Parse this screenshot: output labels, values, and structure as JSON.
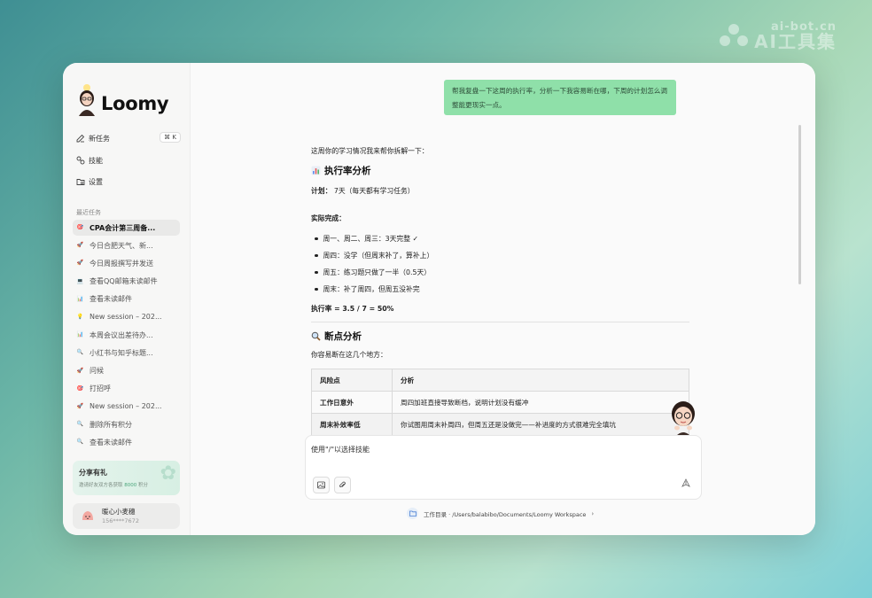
{
  "watermark": {
    "url": "ai-bot.cn",
    "name": "AI工具集"
  },
  "app": {
    "name": "Loomy"
  },
  "sidebar": {
    "menu": [
      {
        "label": "新任务",
        "shortcut": "⌘ K"
      },
      {
        "label": "技能"
      },
      {
        "label": "设置"
      }
    ],
    "recent_label": "最近任务",
    "recent": [
      {
        "label": "CPA会计第三周备...",
        "icon": "🎯"
      },
      {
        "label": "今日合肥天气、新...",
        "icon": "🚀"
      },
      {
        "label": "今日周报撰写并发送",
        "icon": "🚀"
      },
      {
        "label": "查看QQ邮箱未读邮件",
        "icon": "💻"
      },
      {
        "label": "查看未读邮件",
        "icon": "📊"
      },
      {
        "label": "New session – 202...",
        "icon": "💡"
      },
      {
        "label": "本周会议出差待办...",
        "icon": "📊"
      },
      {
        "label": "小红书与知乎标题...",
        "icon": "🔍"
      },
      {
        "label": "问候",
        "icon": "🚀"
      },
      {
        "label": "打招呼",
        "icon": "🎯"
      },
      {
        "label": "New session – 202...",
        "icon": "🚀"
      },
      {
        "label": "删除所有积分",
        "icon": "🔍"
      },
      {
        "label": "查看未读邮件",
        "icon": "🔍"
      }
    ],
    "share": {
      "title": "分享有礼",
      "desc_prefix": "邀请好友双方各获取",
      "points": "8000",
      "desc_suffix": "积分"
    },
    "user": {
      "name": "暖心小麦穗",
      "phone": "156****7672"
    }
  },
  "chat": {
    "user_message": "帮我复盘一下这周的执行率，分析一下我容易断在哪，下周的计划怎么调整能更现实一点。",
    "intro": "这周你的学习情况我来帮你拆解一下：",
    "section1_title": "执行率分析",
    "plan_label": "计划：",
    "plan_value": "7天（每天都有学习任务）",
    "done_label": "实际完成：",
    "bullets": [
      "周一、周二、周三：3天完整 ✓",
      "周四：没学（但周末补了，算补上）",
      "周五：练习题只做了一半（0.5天）",
      "周末：补了周四，但周五没补完"
    ],
    "rate": "执行率 = 3.5 / 7 = 50%",
    "section2_title": "断点分析",
    "prone_intro": "你容易断在这几个地方：",
    "table": {
      "headers": [
        "风险点",
        "分析"
      ],
      "rows": [
        [
          "工作日意外",
          "周四加班直接导致断档，说明计划没有缓冲"
        ],
        [
          "周末补效率低",
          "你试图用周末补周四，但周五还是没做完——补进度的方式很难完全填坑"
        ]
      ]
    }
  },
  "composer": {
    "placeholder": "使用\"/\"以选择技能"
  },
  "workspace": {
    "label": "工作目录 · /Users/balabibo/Documents/Loomy Workspace"
  }
}
